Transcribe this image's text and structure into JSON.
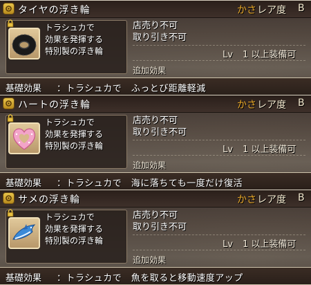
{
  "accessories": [
    {
      "name": "タイヤの浮き輪",
      "icon": "tire-float-icon",
      "desc": [
        "トラシュカで",
        "効果を発揮する",
        "特別製の浮き輪"
      ],
      "props": [
        "店売り不可",
        "取り引き不可"
      ],
      "level_text": "Lv",
      "level": "1",
      "level_suffix": "以上装備可",
      "sub_effect_label": "追加効果",
      "base_label": "基礎効果",
      "base_value": "：トラシュカで　ふっとび距離軽減",
      "kasa": "かさ",
      "rarity_label": "レア度",
      "rarity": "B"
    },
    {
      "name": "ハートの浮き輪",
      "icon": "heart-float-icon",
      "desc": [
        "トラシュカで",
        "効果を発揮する",
        "特別製の浮き輪"
      ],
      "props": [
        "店売り不可",
        "取り引き不可"
      ],
      "level_text": "Lv",
      "level": "1",
      "level_suffix": "以上装備可",
      "sub_effect_label": "追加効果",
      "base_label": "基礎効果",
      "base_value": "：トラシュカで　海に落ちても一度だけ復活",
      "kasa": "かさ",
      "rarity_label": "レア度",
      "rarity": "B"
    },
    {
      "name": "サメの浮き輪",
      "icon": "shark-float-icon",
      "desc": [
        "トラシュカで",
        "効果を発揮する",
        "特別製の浮き輪"
      ],
      "props": [
        "店売り不可",
        "取り引き不可"
      ],
      "level_text": "Lv",
      "level": "1",
      "level_suffix": "以上装備可",
      "sub_effect_label": "追加効果",
      "base_label": "基礎効果",
      "base_value": "：トラシュカで　魚を取ると移動速度アップ",
      "kasa": "かさ",
      "rarity_label": "レア度",
      "rarity": "B"
    }
  ]
}
